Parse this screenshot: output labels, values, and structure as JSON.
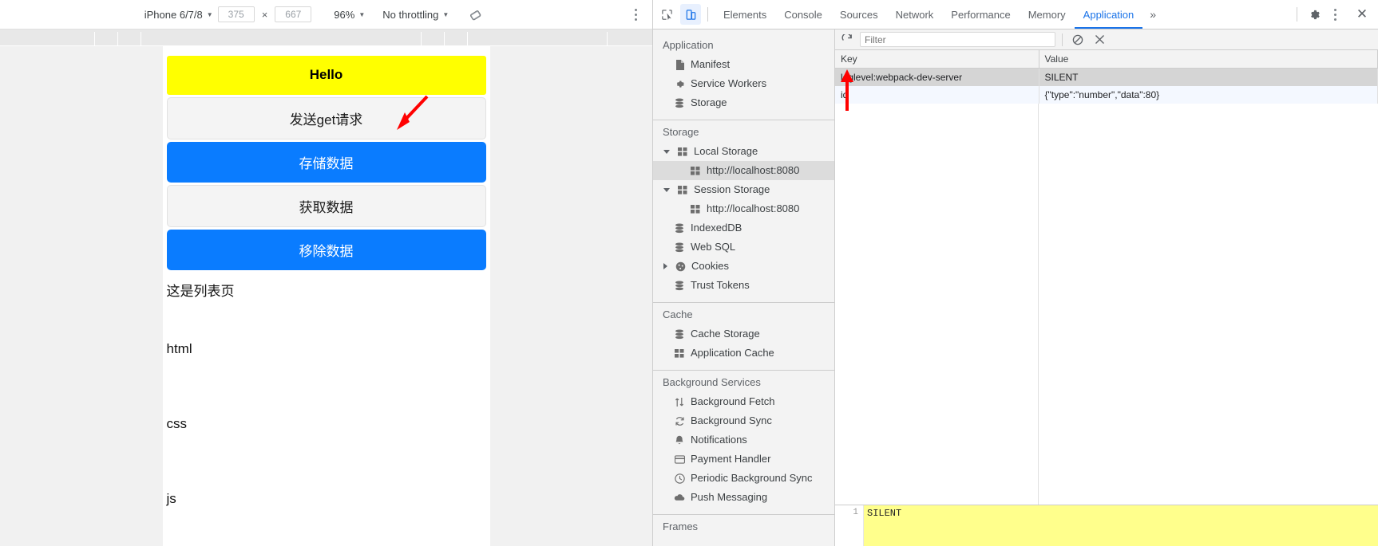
{
  "device_toolbar": {
    "device": "iPhone 6/7/8",
    "width": "375",
    "height": "667",
    "x_separator": "×",
    "zoom": "96%",
    "throttling": "No throttling",
    "rotate_icon": "rotate-device-icon",
    "menu_icon": "more-options-icon"
  },
  "page": {
    "heading": "Hello",
    "buttons": [
      {
        "label": "发送get请求",
        "style": "light"
      },
      {
        "label": "存储数据",
        "style": "blue"
      },
      {
        "label": "获取数据",
        "style": "light"
      },
      {
        "label": "移除数据",
        "style": "blue"
      }
    ],
    "texts": [
      "这是列表页",
      "html",
      "css",
      "js"
    ]
  },
  "devtools": {
    "inspect_icon": "inspect-element-icon",
    "device_toggle_icon": "device-toolbar-icon",
    "tabs": [
      {
        "label": "Elements",
        "active": false
      },
      {
        "label": "Console",
        "active": false
      },
      {
        "label": "Sources",
        "active": false
      },
      {
        "label": "Network",
        "active": false
      },
      {
        "label": "Performance",
        "active": false
      },
      {
        "label": "Memory",
        "active": false
      },
      {
        "label": "Application",
        "active": true
      }
    ],
    "more_tabs": "»",
    "settings_icon": "gear-icon",
    "kebab_icon": "more-tools-icon",
    "close_icon": "close-icon",
    "sidebar": {
      "sections": [
        {
          "title": "Application",
          "items": [
            {
              "label": "Manifest",
              "icon": "manifest-file-icon",
              "indent": 1
            },
            {
              "label": "Service Workers",
              "icon": "gear-icon",
              "indent": 1
            },
            {
              "label": "Storage",
              "icon": "database-icon",
              "indent": 1
            }
          ]
        },
        {
          "title": "Storage",
          "items": [
            {
              "label": "Local Storage",
              "icon": "table-icon",
              "indent": 1,
              "expanded": true
            },
            {
              "label": "http://localhost:8080",
              "icon": "table-icon",
              "indent": 2,
              "selected": true
            },
            {
              "label": "Session Storage",
              "icon": "table-icon",
              "indent": 1,
              "expanded": true
            },
            {
              "label": "http://localhost:8080",
              "icon": "table-icon",
              "indent": 2
            },
            {
              "label": "IndexedDB",
              "icon": "database-icon",
              "indent": 1
            },
            {
              "label": "Web SQL",
              "icon": "database-icon",
              "indent": 1
            },
            {
              "label": "Cookies",
              "icon": "cookie-icon",
              "indent": 1,
              "collapsed": true
            },
            {
              "label": "Trust Tokens",
              "icon": "database-icon",
              "indent": 1
            }
          ]
        },
        {
          "title": "Cache",
          "items": [
            {
              "label": "Cache Storage",
              "icon": "database-icon",
              "indent": 1
            },
            {
              "label": "Application Cache",
              "icon": "table-icon",
              "indent": 1
            }
          ]
        },
        {
          "title": "Background Services",
          "items": [
            {
              "label": "Background Fetch",
              "icon": "arrows-updown-icon",
              "indent": 1
            },
            {
              "label": "Background Sync",
              "icon": "sync-icon",
              "indent": 1
            },
            {
              "label": "Notifications",
              "icon": "bell-icon",
              "indent": 1
            },
            {
              "label": "Payment Handler",
              "icon": "card-icon",
              "indent": 1
            },
            {
              "label": "Periodic Background Sync",
              "icon": "clock-icon",
              "indent": 1
            },
            {
              "label": "Push Messaging",
              "icon": "cloud-icon",
              "indent": 1
            }
          ]
        },
        {
          "title": "Frames",
          "items": []
        }
      ]
    },
    "toolbar": {
      "refresh_icon": "refresh-icon",
      "filter_placeholder": "Filter",
      "clear_all_icon": "clear-all-icon",
      "delete_icon": "delete-selected-icon"
    },
    "storage_table": {
      "columns": [
        "Key",
        "Value"
      ],
      "rows": [
        {
          "key": "loglevel:webpack-dev-server",
          "value": "SILENT",
          "selected": true
        },
        {
          "key": "id",
          "value": "{\"type\":\"number\",\"data\":80}",
          "selected": false
        }
      ]
    },
    "preview": {
      "line_number": "1",
      "content": "SILENT"
    }
  },
  "annotations": {
    "arrow_color": "#ff0000",
    "arrows": [
      "arrow-pointing-to-store-data-button",
      "arrow-pointing-to-id-key"
    ]
  }
}
